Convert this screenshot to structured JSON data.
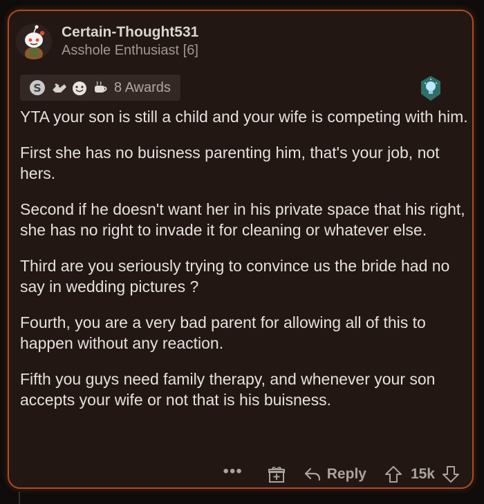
{
  "comment": {
    "author": "Certain-Thought531",
    "flair": "Asshole Enthusiast [6]",
    "awards_label": "8 Awards",
    "paragraphs": [
      "YTA your son is still a child and your wife is competing with him.",
      "First she has no buisness parenting him, that's your job, not hers.",
      "Second if he doesn't want her in his private space that his right, she has no right to invade it for cleaning or whatever else.",
      "Third are you seriously trying to convince us the bride had no say in wedding pictures ?",
      "Fourth, you are a very bad parent for allowing all of this to happen without any reaction.",
      "Fifth you guys need family therapy, and whenever your son accepts your wife or not that is his buisness."
    ]
  },
  "actions": {
    "more_label": "•••",
    "reply_label": "Reply",
    "score": "15k"
  },
  "icons": {
    "avatar": "snoo-avatar",
    "awards": [
      "silver-award-icon",
      "handshake-award-icon",
      "wholesome-award-icon",
      "tea-award-icon"
    ],
    "bulb": "lightbulb-icon",
    "gift": "gift-icon",
    "reply": "reply-arrow-icon",
    "upvote": "upvote-arrow-icon",
    "downvote": "downvote-arrow-icon"
  },
  "colors": {
    "background": "#0f0c0b",
    "card": "#221713",
    "border_accent": "#b44a22",
    "text": "#e4e1de",
    "muted": "#a09893"
  }
}
